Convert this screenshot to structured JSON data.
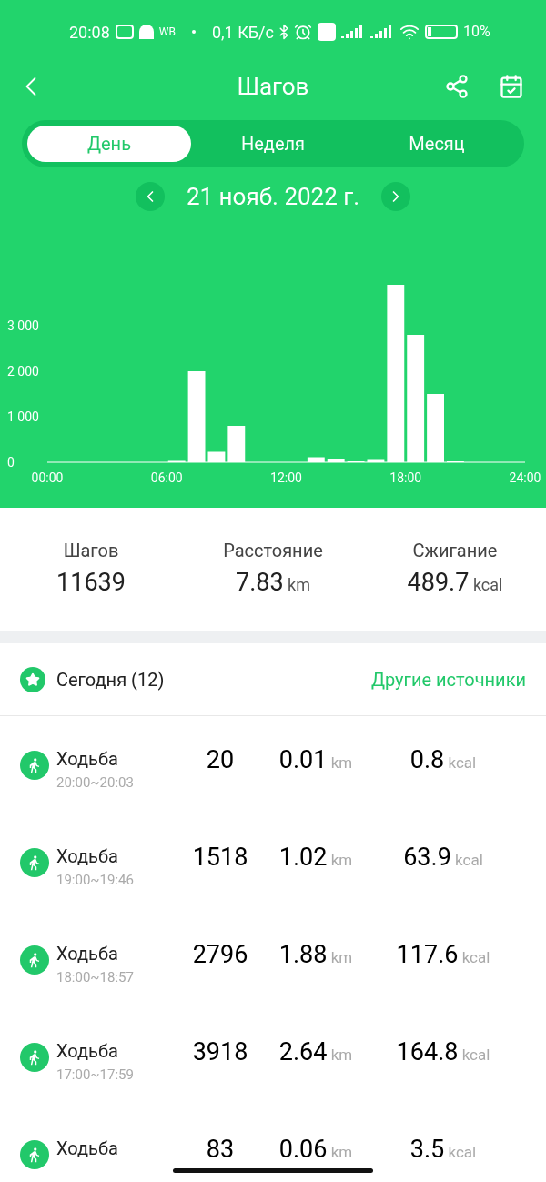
{
  "status_bar": {
    "time": "20:08",
    "notification": "WB",
    "speed": "0,1 КБ/с",
    "battery": "10%"
  },
  "header": {
    "title": "Шагов"
  },
  "tabs": [
    {
      "label": "День",
      "selected": true
    },
    {
      "label": "Неделя",
      "selected": false
    },
    {
      "label": "Месяц",
      "selected": false
    }
  ],
  "date": "21 нояб. 2022 г.",
  "chart_data": {
    "type": "bar",
    "x": [
      0.5,
      1.5,
      2.5,
      3.5,
      4.5,
      5.5,
      6.5,
      7.5,
      8.5,
      9.5,
      10.5,
      11.5,
      12.5,
      13.5,
      14.5,
      15.5,
      16.5,
      17.5,
      18.5,
      19.5,
      20.5,
      21.5,
      22.5,
      23.5
    ],
    "values": [
      0,
      0,
      0,
      0,
      0,
      0,
      30,
      2000,
      230,
      800,
      0,
      0,
      0,
      110,
      80,
      20,
      70,
      3900,
      2800,
      1500,
      20,
      0,
      0,
      0
    ],
    "xlim": [
      0,
      24
    ],
    "ylim": [
      0,
      4000
    ],
    "xticks": [
      {
        "value": 0,
        "label": "00:00"
      },
      {
        "value": 6,
        "label": "06:00"
      },
      {
        "value": 12,
        "label": "12:00"
      },
      {
        "value": 18,
        "label": "18:00"
      },
      {
        "value": 24,
        "label": "24:00"
      }
    ],
    "yticks": [
      {
        "value": 0,
        "label": "0"
      },
      {
        "value": 1000,
        "label": "1 000"
      },
      {
        "value": 2000,
        "label": "2 000"
      },
      {
        "value": 3000,
        "label": "3 000"
      }
    ]
  },
  "summary": [
    {
      "label": "Шагов",
      "value": "11639"
    },
    {
      "label": "Расстояние",
      "value": "7.83",
      "unit": "km"
    },
    {
      "label": "Сжигание",
      "value": "489.7",
      "unit": "kcal"
    }
  ],
  "today": {
    "title": "Сегодня (12)",
    "link": "Другие источники"
  },
  "records": [
    {
      "name": "Ходьба",
      "time": "20:00~20:03",
      "steps": "20",
      "distance": "0.01",
      "distance_unit": "km",
      "calories": "0.8",
      "calories_unit": "kcal"
    },
    {
      "name": "Ходьба",
      "time": "19:00~19:46",
      "steps": "1518",
      "distance": "1.02",
      "distance_unit": "km",
      "calories": "63.9",
      "calories_unit": "kcal"
    },
    {
      "name": "Ходьба",
      "time": "18:00~18:57",
      "steps": "2796",
      "distance": "1.88",
      "distance_unit": "km",
      "calories": "117.6",
      "calories_unit": "kcal"
    },
    {
      "name": "Ходьба",
      "time": "17:00~17:59",
      "steps": "3918",
      "distance": "2.64",
      "distance_unit": "km",
      "calories": "164.8",
      "calories_unit": "kcal"
    },
    {
      "name": "Ходьба",
      "steps": "83",
      "distance": "0.06",
      "distance_unit": "km",
      "calories": "3.5",
      "calories_unit": "kcal"
    }
  ]
}
